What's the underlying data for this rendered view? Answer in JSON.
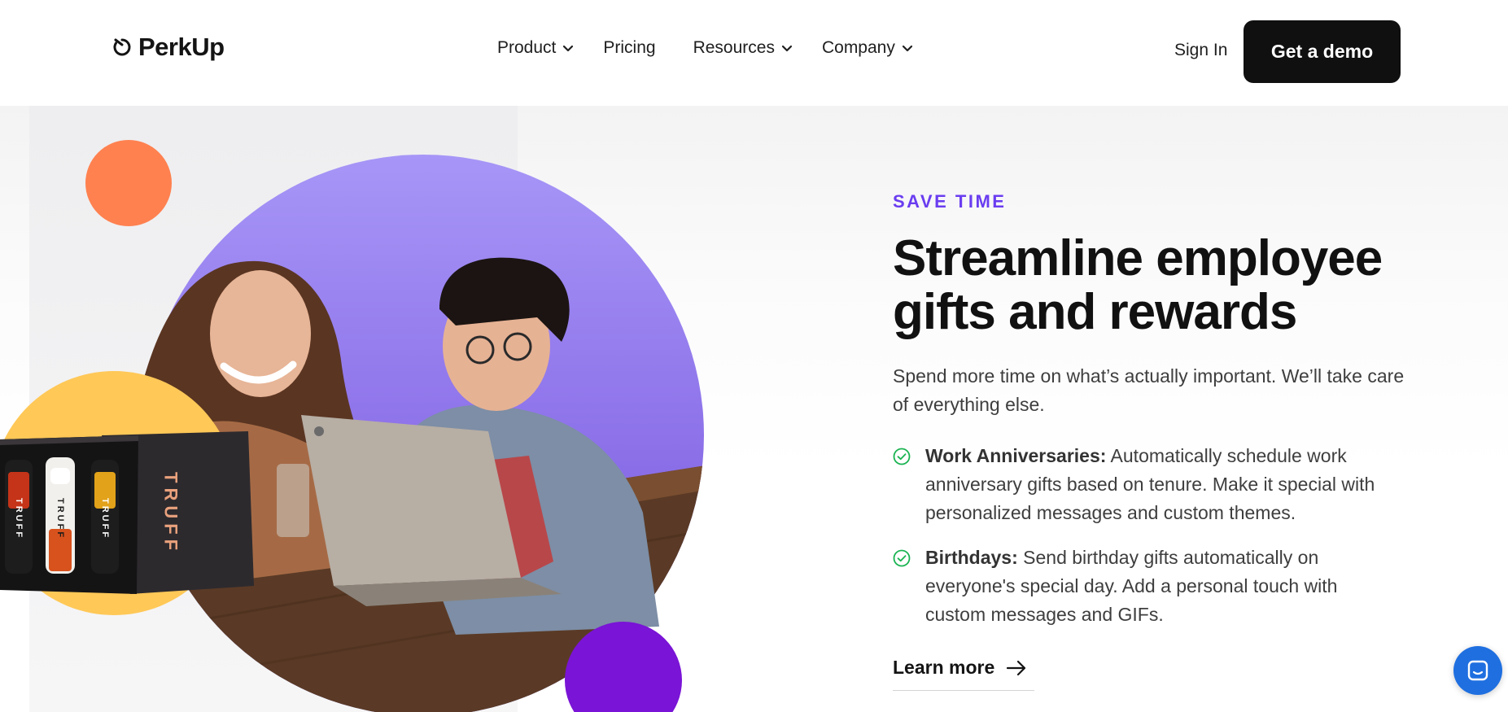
{
  "brand": {
    "name": "PerkUp",
    "icon": "perkup-logo-icon"
  },
  "nav": {
    "items": [
      {
        "label": "Product",
        "has_dropdown": true
      },
      {
        "label": "Pricing",
        "has_dropdown": false
      },
      {
        "label": "Resources",
        "has_dropdown": true
      },
      {
        "label": "Company",
        "has_dropdown": true
      }
    ],
    "sign_in": "Sign In",
    "cta": "Get a demo"
  },
  "hero": {
    "eyebrow": "SAVE TIME",
    "headline_line1": "Streamline employee",
    "headline_line2": "gifts and rewards",
    "subtext": "Spend more time on what’s actually important. We’ll take care of everything else.",
    "features": [
      {
        "title": "Work Anniversaries:",
        "text": " Automatically schedule work anniversary gifts based on tenure. Make it special with personalized messages and custom themes."
      },
      {
        "title": "Birthdays:",
        "text": " Send birthday gifts automatically on everyone's special day. Add a personal touch with custom messages and GIFs."
      }
    ],
    "learn_more": "Learn more",
    "product_box_label": "TRUFF",
    "bottle_labels": [
      "TRUFF",
      "TRUFF",
      "TRUFF"
    ]
  },
  "colors": {
    "accent_purple": "#6a3df0",
    "orange_circle": "#ff8150",
    "yellow_circle": "#ffc857",
    "violet_circle": "#7a14d6",
    "hero_circle": "#9f8cf5",
    "check_green": "#19b351",
    "chat_blue": "#1f6fe0"
  }
}
